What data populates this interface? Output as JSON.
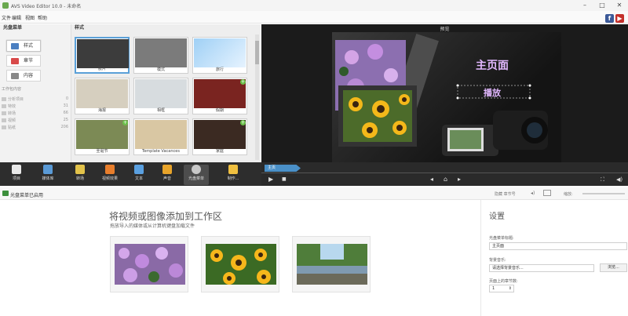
{
  "window": {
    "title": "AVS Video Editor 10.0 - 未命名"
  },
  "menu": [
    "文件",
    "编辑",
    "视图",
    "帮助"
  ],
  "left_nav": {
    "header": "光盘菜单",
    "buttons": [
      {
        "label": "样式",
        "color": "#4a7fc1"
      },
      {
        "label": "章节",
        "color": "#d84a4a"
      },
      {
        "label": "内容",
        "color": "#888888"
      }
    ],
    "section": "工作包内容",
    "tree": [
      {
        "label": "分析项目",
        "count": "0"
      },
      {
        "label": "特效",
        "count": "31"
      },
      {
        "label": "转场",
        "count": "66"
      },
      {
        "label": "视频",
        "count": "25"
      },
      {
        "label": "贴纸",
        "count": "206"
      }
    ]
  },
  "styles_panel": {
    "header": "样式",
    "thumbs": [
      {
        "label": "胶片",
        "bg": "#3c3c3c",
        "selected": true,
        "plus": false
      },
      {
        "label": "模式",
        "bg": "#7b7b7b",
        "selected": false,
        "plus": false
      },
      {
        "label": "旅行",
        "bg": "#b9d6ef",
        "selected": false,
        "plus": false
      },
      {
        "label": "海报",
        "bg": "#d6cfbf",
        "selected": false,
        "plus": false
      },
      {
        "label": "相框",
        "bg": "#d7dcdf",
        "selected": false,
        "plus": false
      },
      {
        "label": "假期",
        "bg": "#7a2420",
        "selected": false,
        "plus": true
      },
      {
        "label": "圣诞节",
        "bg": "#7c8a55",
        "selected": false,
        "plus": true
      },
      {
        "label": "Template Vacances",
        "bg": "#d9c7a3",
        "selected": false,
        "plus": false
      },
      {
        "label": "家庭",
        "bg": "#3b2a22",
        "selected": false,
        "plus": true
      }
    ]
  },
  "preview": {
    "title": "预览",
    "main_title": "主页面",
    "button_text": "播放",
    "accent": "#e2b8ff"
  },
  "toolbar": {
    "tools": [
      {
        "label": "项目",
        "color": "#e8e8e8"
      },
      {
        "label": "媒体库",
        "color": "#5a9ad6"
      },
      {
        "label": "转场",
        "color": "#e2c24a"
      },
      {
        "label": "视频效果",
        "color": "#e87e2c"
      },
      {
        "label": "文本",
        "color": "#5aa0e0"
      },
      {
        "label": "声音",
        "color": "#e8a42a"
      },
      {
        "label": "光盘菜单",
        "color": "#c8c8c8"
      },
      {
        "label": "制作...",
        "color": "#f0c040"
      }
    ]
  },
  "playback": {
    "chip": "主页",
    "play": "▶",
    "stop": "■"
  },
  "lower": {
    "message": "光盘菜单已启用",
    "right_tools": "隐藏 章节号",
    "right_tools2": "缩放:"
  },
  "dropzone": {
    "title": "将视频或图像添加到工作区",
    "subtitle": "拖放导入的媒体或从计算机键盘加载文件"
  },
  "settings": {
    "title": "设置",
    "menu_title_label": "光盘菜单标题:",
    "menu_title_value": "主页面",
    "bg_music_label": "背景音乐:",
    "bg_music_value": "请选择背景音乐...",
    "browse": "浏览...",
    "chapters_label": "页面上的章节数:",
    "chapters_value": "1"
  }
}
